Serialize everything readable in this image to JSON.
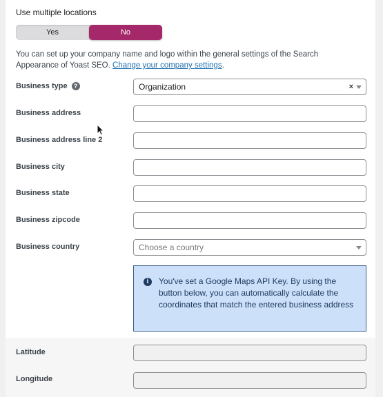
{
  "multiple_locations": {
    "label": "Use multiple locations",
    "options": [
      "Yes",
      "No"
    ],
    "selected": "No"
  },
  "description": {
    "text": "You can set up your company name and logo within the general settings of the Search Appearance of Yoast SEO. ",
    "link": "Change your company settings",
    "suffix": "."
  },
  "fields": {
    "business_type": {
      "label": "Business type",
      "value": "Organization",
      "clear": "×"
    },
    "business_address": {
      "label": "Business address",
      "value": ""
    },
    "business_address_2": {
      "label": "Business address line 2",
      "value": ""
    },
    "business_city": {
      "label": "Business city",
      "value": ""
    },
    "business_state": {
      "label": "Business state",
      "value": ""
    },
    "business_zipcode": {
      "label": "Business zipcode",
      "value": ""
    },
    "business_country": {
      "label": "Business country",
      "placeholder": "Choose a country"
    },
    "latitude": {
      "label": "Latitude",
      "value": ""
    },
    "longitude": {
      "label": "Longitude",
      "value": ""
    }
  },
  "notice": {
    "icon": "info-icon",
    "text": "You've set a Google Maps API Key. By using the button below, you can automatically calculate the coordinates that match the entered business address"
  },
  "colors": {
    "toggle_selected": "#a4286a",
    "notice_bg": "#cce0f9",
    "link": "#2271b1"
  }
}
